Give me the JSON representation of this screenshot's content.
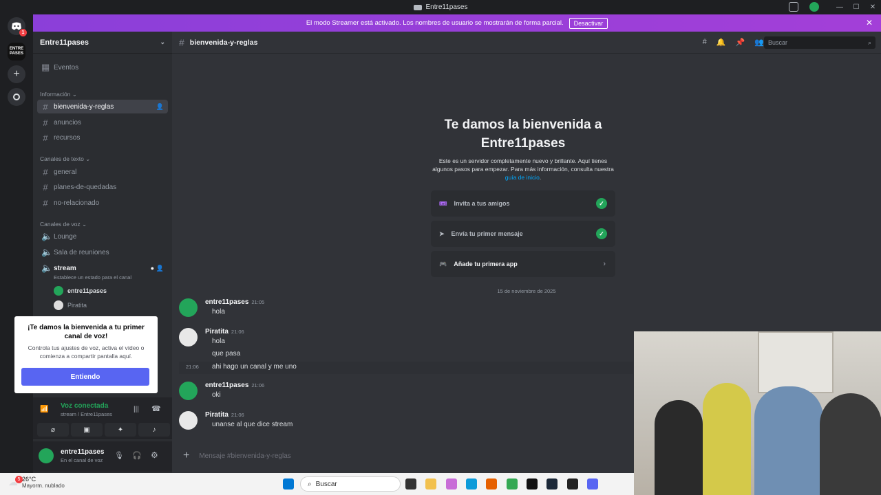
{
  "window": {
    "title": "Entre11pases"
  },
  "streamer_banner": {
    "text": "El modo Streamer está activado. Los nombres de usuario se mostrarán de forma parcial.",
    "button": "Desactivar",
    "close": "✕"
  },
  "guilds": {
    "server_short": "ENTRE PASES",
    "badge_dm": "1"
  },
  "sidebar": {
    "server_name": "Entre11pases",
    "events": "Eventos",
    "cat_info": "Información",
    "info_channels": [
      "bienvenida-y-reglas",
      "anuncios",
      "recursos"
    ],
    "cat_text": "Canales de texto",
    "text_channels": [
      "general",
      "planes-de-quedadas",
      "no-relacionado"
    ],
    "cat_voice": "Canales de voz",
    "voice_channels": [
      "Lounge",
      "Sala de reuniones",
      "stream"
    ],
    "voice_status": "Establece un estado para el canal",
    "voice_users": [
      "entre11pases",
      "Piratita"
    ]
  },
  "popup": {
    "title": "¡Te damos la bienvenida a tu primer canal de voz!",
    "body": "Controla tus ajustes de voz, activa el vídeo o comienza a compartir pantalla aquí.",
    "button": "Entiendo"
  },
  "voice_panel": {
    "status": "Voz conectada",
    "location": "stream / Entre11pases"
  },
  "user_panel": {
    "name": "entre11pases",
    "status": "En el canal de voz"
  },
  "channel_header": {
    "name": "bienvenida-y-reglas",
    "search": "Buscar"
  },
  "welcome": {
    "title": "Te damos la bienvenida a Entre11pases",
    "desc": "Este es un servidor completamente nuevo y brillante. Aquí tienes algunos pasos para empezar. Para más información, consulta nuestra",
    "link": "guía de inicio",
    "period": "."
  },
  "steps": [
    {
      "label": "Invita a tus amigos"
    },
    {
      "label": "Envía tu primer mensaje"
    },
    {
      "label": "Añade tu primera app"
    }
  ],
  "date_divider": "15 de noviembre de 2025",
  "messages": [
    {
      "author": "entre11pases",
      "time": "21:05",
      "lines": [
        "hola"
      ]
    },
    {
      "author": "Piratita",
      "time": "21:06",
      "lines": [
        "hola",
        "que pasa"
      ]
    },
    {
      "time": "21:06",
      "lines": [
        "ahi hago un canal y me uno"
      ]
    },
    {
      "author": "entre11pases",
      "time": "21:06",
      "lines": [
        "oki"
      ]
    },
    {
      "author": "Piratita",
      "time": "21:06",
      "lines": [
        "unanse al que dice stream"
      ]
    }
  ],
  "composer": {
    "placeholder": "Mensaje #bienvenida-y-reglas"
  },
  "taskbar": {
    "temp": "26°C",
    "weather": "Mayorm. nublado",
    "weather_badge": "5",
    "search": "Buscar"
  },
  "colors": {
    "blurple": "#5865f2",
    "streamer": "#a33fd8",
    "green": "#23a55a",
    "link": "#00a8fc"
  }
}
